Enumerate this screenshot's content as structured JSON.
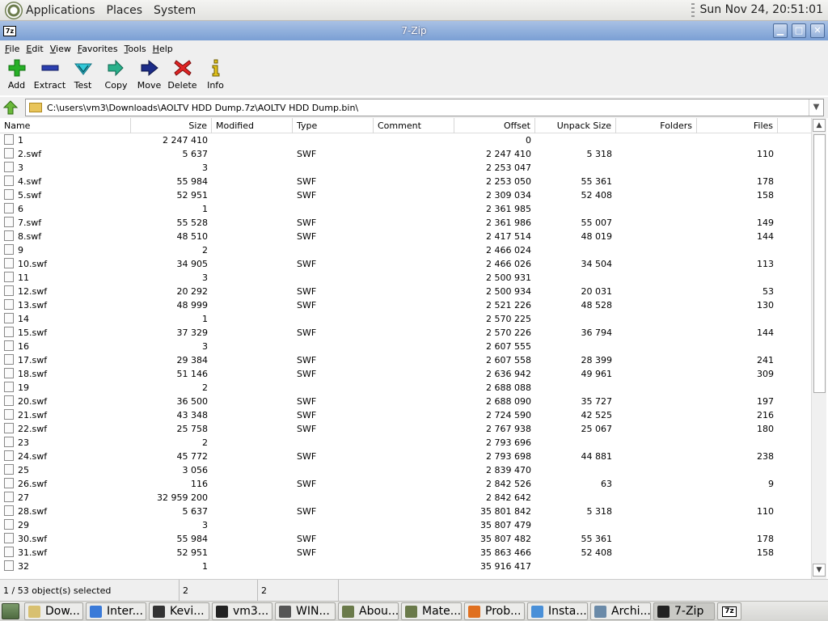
{
  "top_panel": {
    "menus": [
      "Applications",
      "Places",
      "System"
    ],
    "clock": "Sun Nov 24, 20:51:01"
  },
  "window": {
    "title": "7-Zip",
    "icon_label": "7z"
  },
  "menubar": [
    "File",
    "Edit",
    "View",
    "Favorites",
    "Tools",
    "Help"
  ],
  "toolbar": [
    {
      "label": "Add",
      "icon": "plus-icon",
      "color": "#22aa22"
    },
    {
      "label": "Extract",
      "icon": "minus-icon",
      "color": "#2233aa"
    },
    {
      "label": "Test",
      "icon": "check-icon",
      "color": "#22bbcc"
    },
    {
      "label": "Copy",
      "icon": "double-arrow-icon",
      "color": "#22aa88"
    },
    {
      "label": "Move",
      "icon": "arrow-right-icon",
      "color": "#223388"
    },
    {
      "label": "Delete",
      "icon": "x-icon",
      "color": "#dd2222"
    },
    {
      "label": "Info",
      "icon": "info-icon",
      "color": "#ddbb11"
    }
  ],
  "address": {
    "path": "C:\\users\\vm3\\Downloads\\AOLTV HDD Dump.7z\\AOLTV HDD Dump.bin\\"
  },
  "columns": [
    "Name",
    "Size",
    "Modified",
    "Type",
    "Comment",
    "Offset",
    "Unpack Size",
    "Folders",
    "Files"
  ],
  "rows": [
    {
      "name": "1",
      "size": "2 247 410",
      "type": "",
      "offset": "0",
      "unpack": "",
      "files": ""
    },
    {
      "name": "2.swf",
      "size": "5 637",
      "type": "SWF",
      "offset": "2 247 410",
      "unpack": "5 318",
      "files": "110"
    },
    {
      "name": "3",
      "size": "3",
      "type": "",
      "offset": "2 253 047",
      "unpack": "",
      "files": ""
    },
    {
      "name": "4.swf",
      "size": "55 984",
      "type": "SWF",
      "offset": "2 253 050",
      "unpack": "55 361",
      "files": "178"
    },
    {
      "name": "5.swf",
      "size": "52 951",
      "type": "SWF",
      "offset": "2 309 034",
      "unpack": "52 408",
      "files": "158"
    },
    {
      "name": "6",
      "size": "1",
      "type": "",
      "offset": "2 361 985",
      "unpack": "",
      "files": ""
    },
    {
      "name": "7.swf",
      "size": "55 528",
      "type": "SWF",
      "offset": "2 361 986",
      "unpack": "55 007",
      "files": "149"
    },
    {
      "name": "8.swf",
      "size": "48 510",
      "type": "SWF",
      "offset": "2 417 514",
      "unpack": "48 019",
      "files": "144"
    },
    {
      "name": "9",
      "size": "2",
      "type": "",
      "offset": "2 466 024",
      "unpack": "",
      "files": ""
    },
    {
      "name": "10.swf",
      "size": "34 905",
      "type": "SWF",
      "offset": "2 466 026",
      "unpack": "34 504",
      "files": "113"
    },
    {
      "name": "11",
      "size": "3",
      "type": "",
      "offset": "2 500 931",
      "unpack": "",
      "files": ""
    },
    {
      "name": "12.swf",
      "size": "20 292",
      "type": "SWF",
      "offset": "2 500 934",
      "unpack": "20 031",
      "files": "53"
    },
    {
      "name": "13.swf",
      "size": "48 999",
      "type": "SWF",
      "offset": "2 521 226",
      "unpack": "48 528",
      "files": "130"
    },
    {
      "name": "14",
      "size": "1",
      "type": "",
      "offset": "2 570 225",
      "unpack": "",
      "files": ""
    },
    {
      "name": "15.swf",
      "size": "37 329",
      "type": "SWF",
      "offset": "2 570 226",
      "unpack": "36 794",
      "files": "144"
    },
    {
      "name": "16",
      "size": "3",
      "type": "",
      "offset": "2 607 555",
      "unpack": "",
      "files": ""
    },
    {
      "name": "17.swf",
      "size": "29 384",
      "type": "SWF",
      "offset": "2 607 558",
      "unpack": "28 399",
      "files": "241"
    },
    {
      "name": "18.swf",
      "size": "51 146",
      "type": "SWF",
      "offset": "2 636 942",
      "unpack": "49 961",
      "files": "309"
    },
    {
      "name": "19",
      "size": "2",
      "type": "",
      "offset": "2 688 088",
      "unpack": "",
      "files": ""
    },
    {
      "name": "20.swf",
      "size": "36 500",
      "type": "SWF",
      "offset": "2 688 090",
      "unpack": "35 727",
      "files": "197"
    },
    {
      "name": "21.swf",
      "size": "43 348",
      "type": "SWF",
      "offset": "2 724 590",
      "unpack": "42 525",
      "files": "216"
    },
    {
      "name": "22.swf",
      "size": "25 758",
      "type": "SWF",
      "offset": "2 767 938",
      "unpack": "25 067",
      "files": "180"
    },
    {
      "name": "23",
      "size": "2",
      "type": "",
      "offset": "2 793 696",
      "unpack": "",
      "files": ""
    },
    {
      "name": "24.swf",
      "size": "45 772",
      "type": "SWF",
      "offset": "2 793 698",
      "unpack": "44 881",
      "files": "238"
    },
    {
      "name": "25",
      "size": "3 056",
      "type": "",
      "offset": "2 839 470",
      "unpack": "",
      "files": ""
    },
    {
      "name": "26.swf",
      "size": "116",
      "type": "SWF",
      "offset": "2 842 526",
      "unpack": "63",
      "files": "9"
    },
    {
      "name": "27",
      "size": "32 959 200",
      "type": "",
      "offset": "2 842 642",
      "unpack": "",
      "files": ""
    },
    {
      "name": "28.swf",
      "size": "5 637",
      "type": "SWF",
      "offset": "35 801 842",
      "unpack": "5 318",
      "files": "110"
    },
    {
      "name": "29",
      "size": "3",
      "type": "",
      "offset": "35 807 479",
      "unpack": "",
      "files": ""
    },
    {
      "name": "30.swf",
      "size": "55 984",
      "type": "SWF",
      "offset": "35 807 482",
      "unpack": "55 361",
      "files": "178"
    },
    {
      "name": "31.swf",
      "size": "52 951",
      "type": "SWF",
      "offset": "35 863 466",
      "unpack": "52 408",
      "files": "158"
    },
    {
      "name": "32",
      "size": "1",
      "type": "",
      "offset": "35 916 417",
      "unpack": "",
      "files": ""
    }
  ],
  "status": {
    "selection": "1 / 53 object(s) selected",
    "size": "2",
    "packed": "2"
  },
  "taskbar": [
    {
      "label": "Dow...",
      "icon": "folder-icon",
      "color": "#d8c070"
    },
    {
      "label": "Inter...",
      "icon": "browser-icon",
      "color": "#3a7ad8"
    },
    {
      "label": "Kevi...",
      "icon": "app-icon",
      "color": "#333333"
    },
    {
      "label": "vm3...",
      "icon": "terminal-icon",
      "color": "#222222"
    },
    {
      "label": "WIN...",
      "icon": "window-icon",
      "color": "#555555"
    },
    {
      "label": "Abou...",
      "icon": "info-icon",
      "color": "#6a7a4a"
    },
    {
      "label": "Mate...",
      "icon": "settings-icon",
      "color": "#6a7a4a"
    },
    {
      "label": "Prob...",
      "icon": "firefox-icon",
      "color": "#e07020"
    },
    {
      "label": "Insta...",
      "icon": "windows-icon",
      "color": "#4a90d8"
    },
    {
      "label": "Archi...",
      "icon": "archive-icon",
      "color": "#6a8aa8"
    },
    {
      "label": "7-Zip",
      "icon": "sevenzip-icon",
      "color": "#222222"
    }
  ],
  "tray_label": "7z"
}
